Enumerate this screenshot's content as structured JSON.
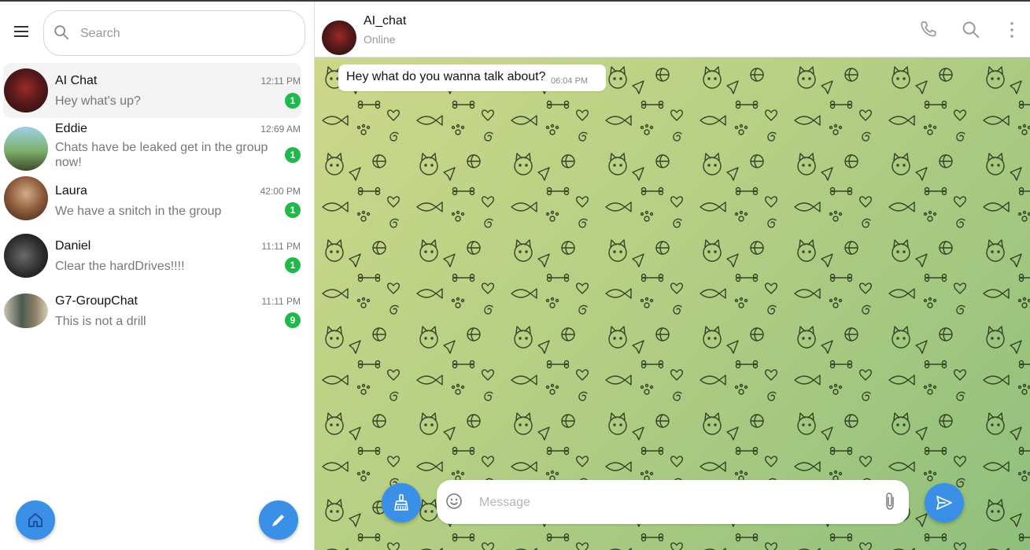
{
  "sidebar": {
    "search_placeholder": "Search",
    "chats": [
      {
        "name": "AI Chat",
        "time": "12:11 PM",
        "preview": "Hey what's up?",
        "unread": "1"
      },
      {
        "name": "Eddie",
        "time": "12:69 AM",
        "preview": "Chats have be leaked get in the group now!",
        "unread": "1"
      },
      {
        "name": "Laura",
        "time": "42:00 PM",
        "preview": "We have a snitch in the group",
        "unread": "1"
      },
      {
        "name": "Daniel",
        "time": "11:11 PM",
        "preview": "Clear the hardDrives!!!!",
        "unread": "1"
      },
      {
        "name": "G7-GroupChat",
        "time": "11:11 PM",
        "preview": "This is not a drill",
        "unread": "9"
      }
    ]
  },
  "header": {
    "title": "AI_chat",
    "status": "Online"
  },
  "messages": [
    {
      "text": "Hey what do you wanna talk about?",
      "time": "06:04 PM"
    }
  ],
  "composer": {
    "placeholder": "Message"
  },
  "colors": {
    "accent": "#3a90e6",
    "unread_badge": "#1fb84b",
    "wallpaper_start": "#cdd78a",
    "wallpaper_end": "#8fbf7c"
  },
  "icons": [
    "menu-icon",
    "search-icon",
    "home-icon",
    "pencil-icon",
    "phone-icon",
    "more-vertical-icon",
    "brush-icon",
    "emoji-icon",
    "paperclip-icon",
    "send-icon"
  ]
}
